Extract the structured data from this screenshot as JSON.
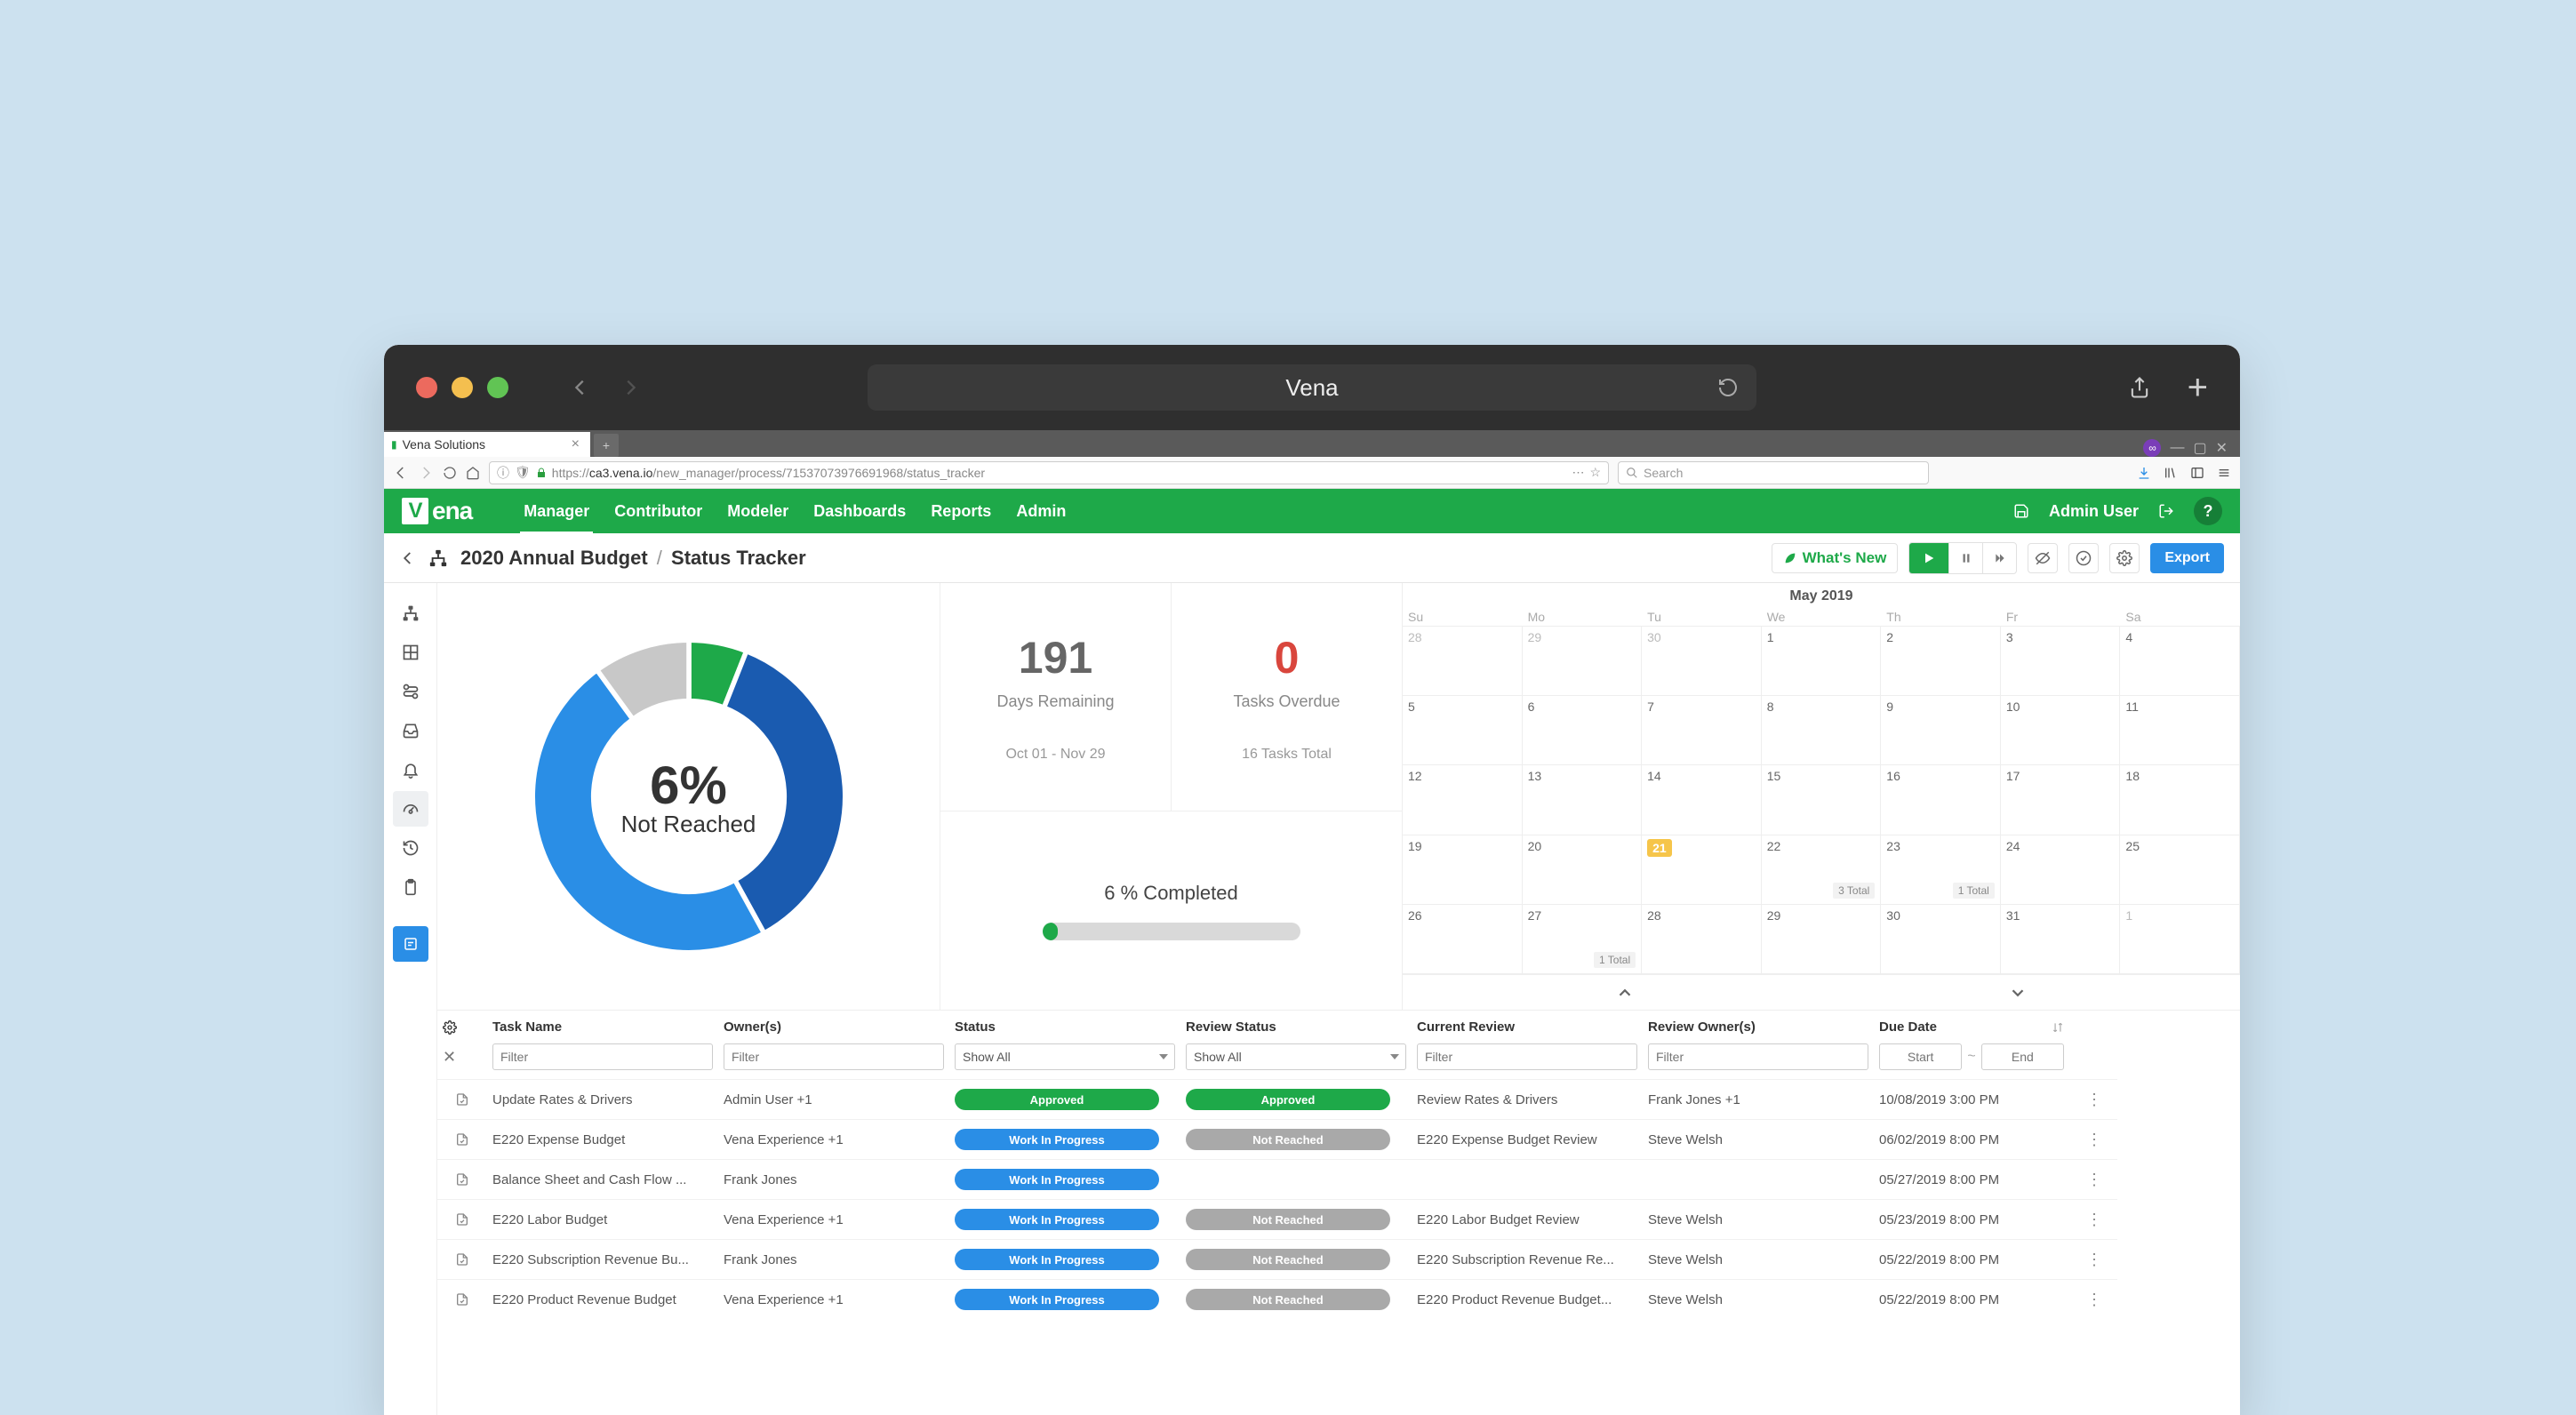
{
  "titlebar": {
    "site": "Vena"
  },
  "firefox_tab": {
    "title": "Vena Solutions"
  },
  "url_bar": {
    "scheme": "https://",
    "host": "ca3.vena.io",
    "path": "/new_manager/process/71537073976691968/status_tracker",
    "search_placeholder": "Search"
  },
  "app_header": {
    "logo": "Vena",
    "nav": [
      "Manager",
      "Contributor",
      "Modeler",
      "Dashboards",
      "Reports",
      "Admin"
    ],
    "active_nav": "Manager",
    "user": "Admin User"
  },
  "breadcrumb": {
    "root": "2020 Annual Budget",
    "page": "Status Tracker",
    "whats_new": "What's New",
    "export": "Export"
  },
  "chart_data": {
    "type": "pie",
    "title": "",
    "center_value": "6%",
    "center_label": "Not Reached",
    "series": [
      {
        "name": "Completed",
        "value": 6,
        "color": "#1ea949"
      },
      {
        "name": "In Progress Dark",
        "value": 36,
        "color": "#1a5bb0"
      },
      {
        "name": "In Progress Light",
        "value": 48,
        "color": "#2a8ee6"
      },
      {
        "name": "Not Reached",
        "value": 10,
        "color": "#c8c8c8"
      }
    ]
  },
  "stats": {
    "days_remaining": {
      "value": "191",
      "label": "Days Remaining",
      "sub": "Oct 01 - Nov 29"
    },
    "tasks_overdue": {
      "value": "0",
      "label": "Tasks Overdue",
      "sub": "16 Tasks Total"
    },
    "progress": {
      "label": "6 % Completed",
      "pct": 6
    }
  },
  "calendar": {
    "title": "May 2019",
    "day_headers": [
      "Su",
      "Mo",
      "Tu",
      "We",
      "Th",
      "Fr",
      "Sa"
    ],
    "weeks": [
      [
        {
          "n": "28",
          "dim": true
        },
        {
          "n": "29",
          "dim": true
        },
        {
          "n": "30",
          "dim": true
        },
        {
          "n": "1"
        },
        {
          "n": "2"
        },
        {
          "n": "3"
        },
        {
          "n": "4"
        }
      ],
      [
        {
          "n": "5"
        },
        {
          "n": "6"
        },
        {
          "n": "7"
        },
        {
          "n": "8"
        },
        {
          "n": "9"
        },
        {
          "n": "10"
        },
        {
          "n": "11"
        }
      ],
      [
        {
          "n": "12"
        },
        {
          "n": "13"
        },
        {
          "n": "14"
        },
        {
          "n": "15"
        },
        {
          "n": "16"
        },
        {
          "n": "17"
        },
        {
          "n": "18"
        }
      ],
      [
        {
          "n": "19"
        },
        {
          "n": "20"
        },
        {
          "n": "21",
          "today": true
        },
        {
          "n": "22",
          "badge": "3 Total"
        },
        {
          "n": "23",
          "badge": "1 Total"
        },
        {
          "n": "24"
        },
        {
          "n": "25"
        }
      ],
      [
        {
          "n": "26"
        },
        {
          "n": "27",
          "badge": "1 Total"
        },
        {
          "n": "28"
        },
        {
          "n": "29"
        },
        {
          "n": "30"
        },
        {
          "n": "31"
        },
        {
          "n": "1",
          "dim": true
        }
      ]
    ]
  },
  "table": {
    "columns": {
      "task": "Task Name",
      "owner": "Owner(s)",
      "status": "Status",
      "review_status": "Review Status",
      "current_review": "Current Review",
      "review_owner": "Review Owner(s)",
      "due": "Due Date"
    },
    "filters": {
      "filter_placeholder": "Filter",
      "show_all": "Show All",
      "start": "Start",
      "end": "End"
    },
    "status_labels": {
      "approved": "Approved",
      "wip": "Work In Progress",
      "notreached": "Not Reached"
    },
    "rows": [
      {
        "task": "Update Rates & Drivers",
        "owner": "Admin User +1",
        "status": "approved",
        "review_status": "approved",
        "current_review": "Review Rates & Drivers",
        "review_owner": "Frank Jones +1",
        "due": "10/08/2019 3:00 PM"
      },
      {
        "task": "E220 Expense Budget",
        "owner": "Vena Experience +1",
        "status": "wip",
        "review_status": "notreached",
        "current_review": "E220 Expense Budget Review",
        "review_owner": "Steve Welsh",
        "due": "06/02/2019 8:00 PM"
      },
      {
        "task": "Balance Sheet and Cash Flow ...",
        "owner": "Frank Jones",
        "status": "wip",
        "review_status": "",
        "current_review": "",
        "review_owner": "",
        "due": "05/27/2019 8:00 PM"
      },
      {
        "task": "E220 Labor Budget",
        "owner": "Vena Experience +1",
        "status": "wip",
        "review_status": "notreached",
        "current_review": "E220 Labor Budget Review",
        "review_owner": "Steve Welsh",
        "due": "05/23/2019 8:00 PM"
      },
      {
        "task": "E220 Subscription Revenue Bu...",
        "owner": "Frank Jones",
        "status": "wip",
        "review_status": "notreached",
        "current_review": "E220 Subscription Revenue Re...",
        "review_owner": "Steve Welsh",
        "due": "05/22/2019 8:00 PM"
      },
      {
        "task": "E220 Product Revenue Budget",
        "owner": "Vena Experience +1",
        "status": "wip",
        "review_status": "notreached",
        "current_review": "E220 Product Revenue Budget...",
        "review_owner": "Steve Welsh",
        "due": "05/22/2019 8:00 PM"
      }
    ]
  }
}
